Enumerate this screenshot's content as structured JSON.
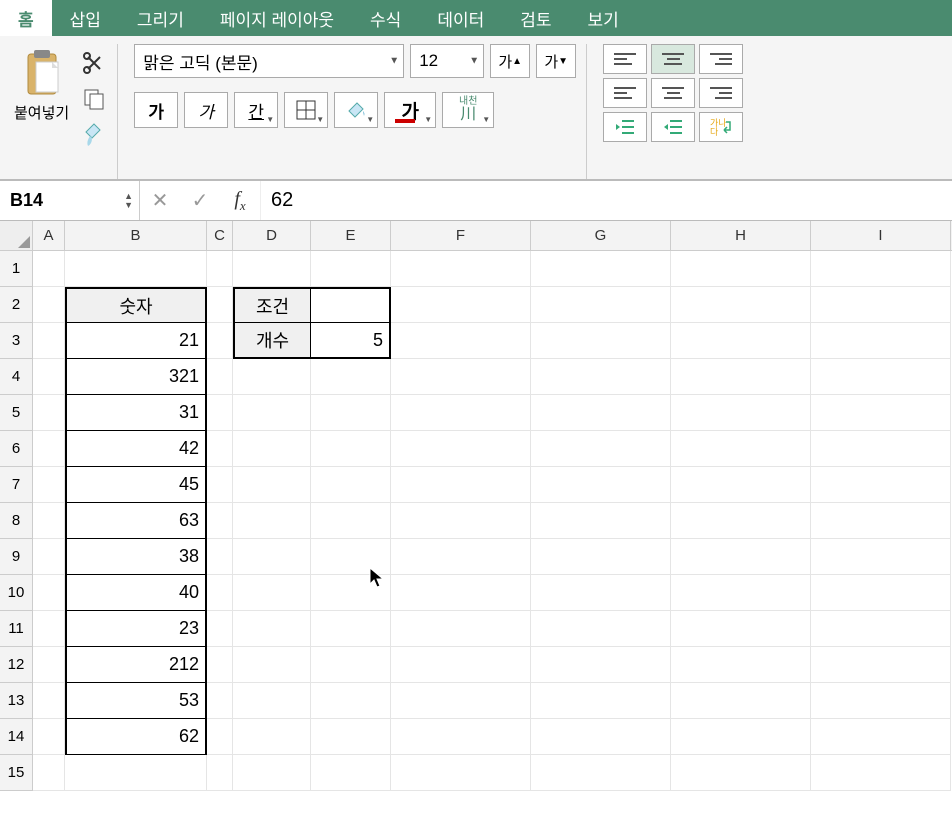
{
  "ribbon": {
    "tabs": [
      "홈",
      "삽입",
      "그리기",
      "페이지 레이아웃",
      "수식",
      "데이터",
      "검토",
      "보기"
    ],
    "active_tab": 0,
    "clipboard": {
      "paste_label": "붙여넣기"
    },
    "font": {
      "name": "맑은 고딕 (본문)",
      "size": "12",
      "grow_label": "가",
      "shrink_label": "가",
      "bold_label": "가",
      "italic_label": "가",
      "underline_label": "간",
      "font_color_label": "가",
      "ruby_top": "내천",
      "ruby_bottom": "川"
    }
  },
  "formula_bar": {
    "name_box": "B14",
    "formula": "62"
  },
  "columns": [
    "A",
    "B",
    "C",
    "D",
    "E",
    "F",
    "G",
    "H",
    "I"
  ],
  "col_widths": [
    "wA",
    "wB",
    "wC",
    "wD",
    "wE",
    "wF",
    "wG",
    "wH",
    "wI"
  ],
  "row_count": 15,
  "sheet": {
    "b_header": "숫자",
    "b_values": [
      "21",
      "321",
      "31",
      "42",
      "45",
      "63",
      "38",
      "40",
      "23",
      "212",
      "53",
      "62"
    ],
    "d2": "조건",
    "d3": "개수",
    "e3": "5"
  },
  "chart_data": {
    "type": "table",
    "title": "",
    "tables": [
      {
        "header": "숫자",
        "values": [
          21,
          321,
          31,
          42,
          45,
          63,
          38,
          40,
          23,
          212,
          53,
          62
        ],
        "range": "B2:B14"
      },
      {
        "labels": [
          "조건",
          "개수"
        ],
        "values": [
          null,
          5
        ],
        "range": "D2:E3"
      }
    ]
  }
}
